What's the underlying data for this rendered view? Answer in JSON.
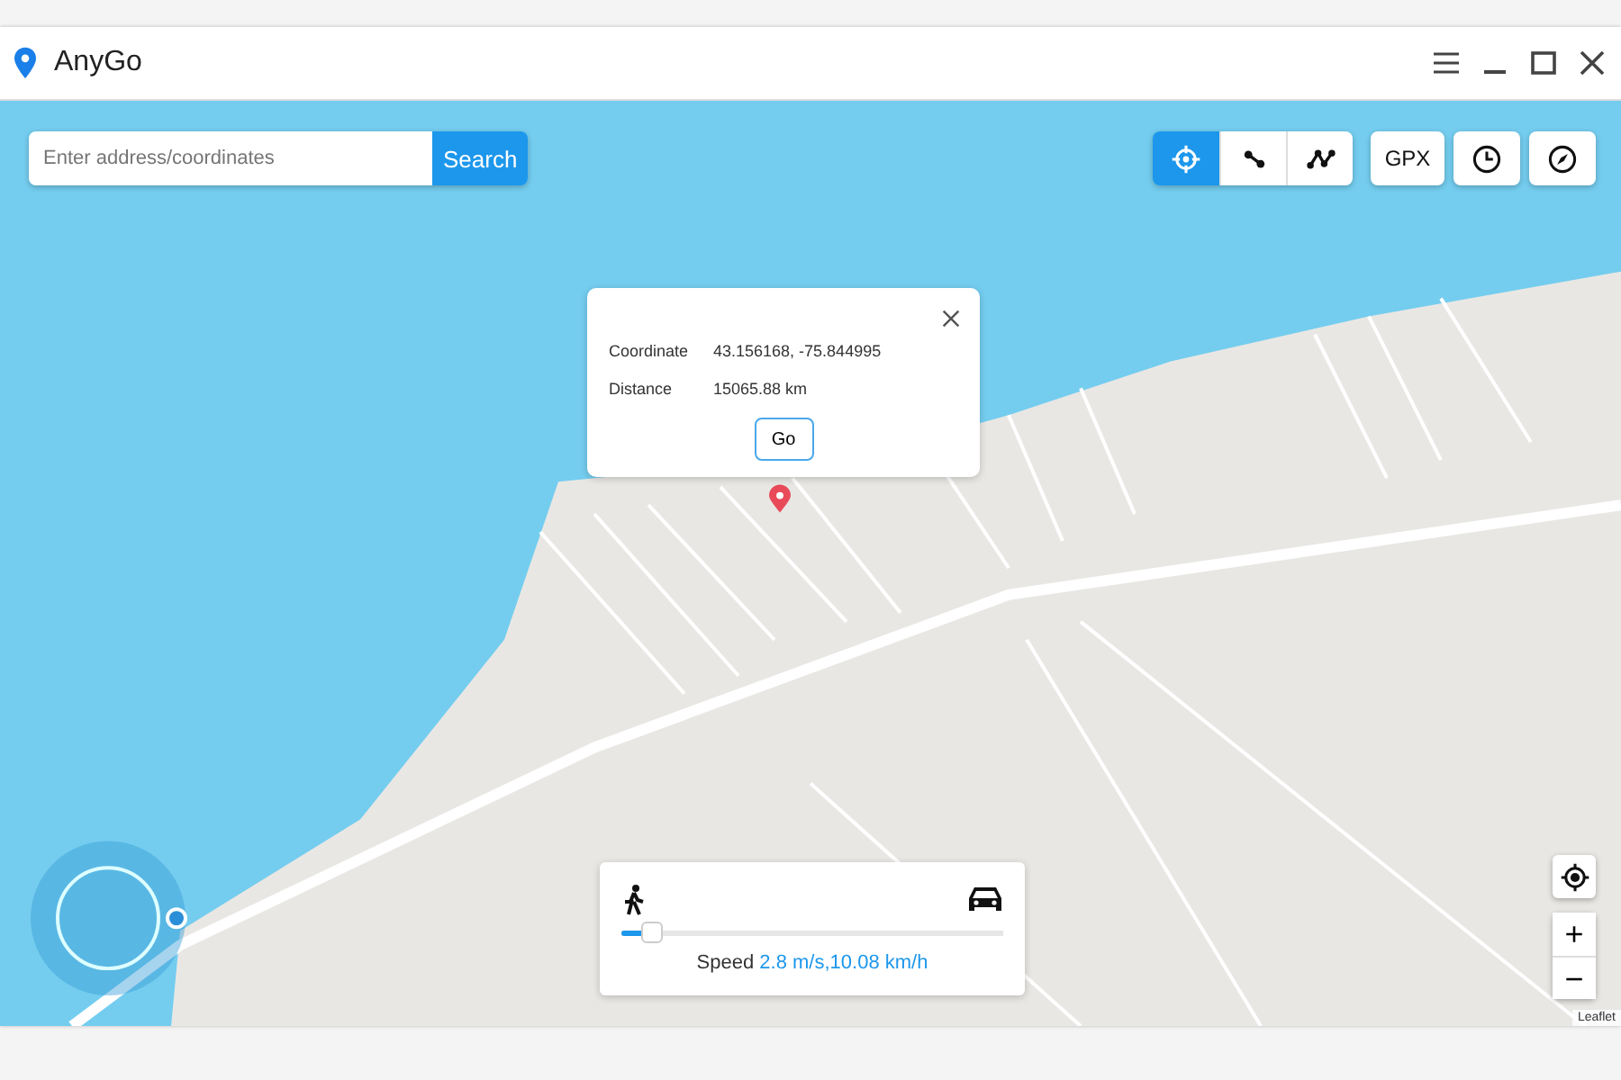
{
  "window": {
    "title": "AnyGo"
  },
  "search": {
    "placeholder": "Enter address/coordinates",
    "button": "Search"
  },
  "modes": [
    {
      "selected": true
    },
    {
      "selected": false
    },
    {
      "selected": false
    }
  ],
  "tools": {
    "gpx": "GPX"
  },
  "popup": {
    "rows": [
      {
        "label": "Coordinate",
        "value": "43.156168, -75.844995"
      },
      {
        "label": "Distance",
        "value": "15065.88 km"
      }
    ],
    "button": "Go"
  },
  "speed": {
    "level": 0.08,
    "label": "Speed",
    "value": "2.8 m/s,10.08 km/h"
  },
  "zoom": {
    "in": "+",
    "out": "−"
  },
  "attribution": "Leaflet"
}
